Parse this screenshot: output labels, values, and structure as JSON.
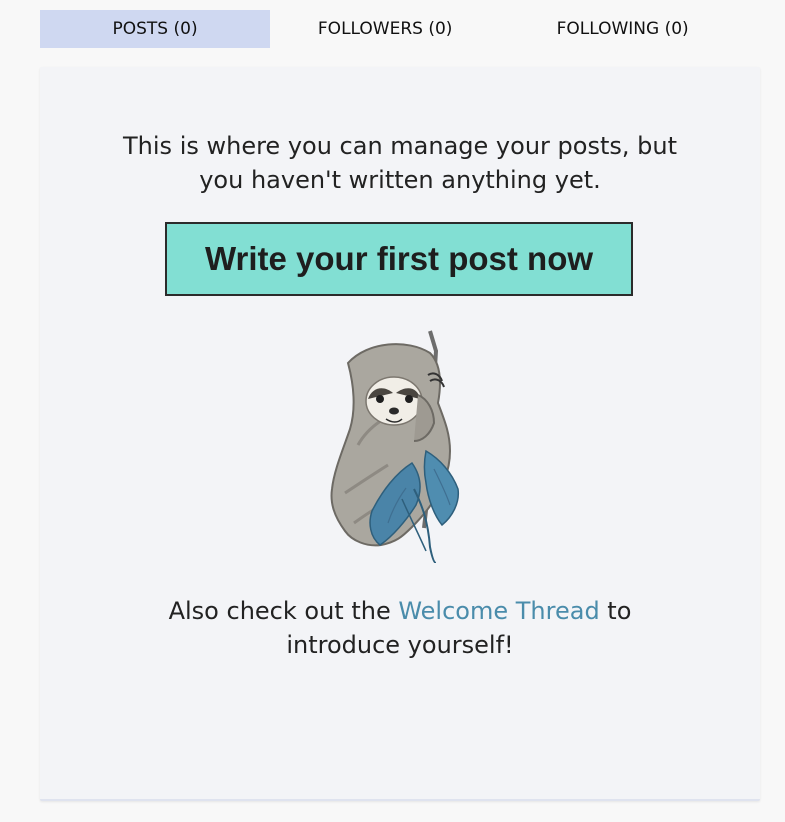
{
  "tabs": [
    {
      "label": "POSTS (0)"
    },
    {
      "label": "FOLLOWERS (0)"
    },
    {
      "label": "FOLLOWING (0)"
    }
  ],
  "empty_state": {
    "intro_text": "This is where you can manage your posts, but you haven't written anything yet.",
    "cta_label": "Write your first post now",
    "illustration_icon": "sloth-with-leaves-icon",
    "footer_prefix": "Also check out the ",
    "footer_link": "Welcome Thread",
    "footer_suffix": " to introduce yourself!"
  },
  "colors": {
    "active_tab": "#cfd8f1",
    "cta_background": "#82dfd3",
    "link": "#4a8cab",
    "leaf": "#4a84a8"
  }
}
